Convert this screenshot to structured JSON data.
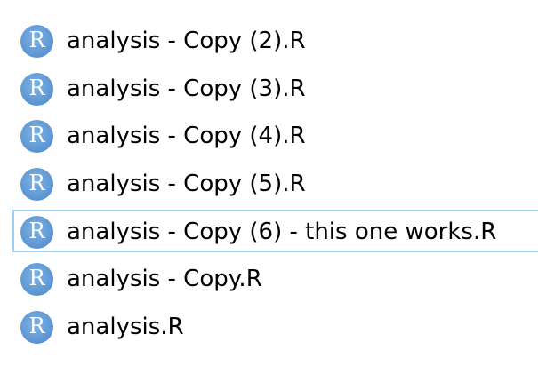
{
  "files": [
    {
      "name": "analysis - Copy (2).R",
      "icon": "r-file-icon",
      "icon_letter": "R"
    },
    {
      "name": "analysis - Copy (3).R",
      "icon": "r-file-icon",
      "icon_letter": "R"
    },
    {
      "name": "analysis - Copy (4).R",
      "icon": "r-file-icon",
      "icon_letter": "R"
    },
    {
      "name": "analysis - Copy (5).R",
      "icon": "r-file-icon",
      "icon_letter": "R"
    },
    {
      "name": "analysis - Copy (6) - this one works.R",
      "icon": "r-file-icon",
      "icon_letter": "R",
      "selected": true
    },
    {
      "name": "analysis - Copy.R",
      "icon": "r-file-icon",
      "icon_letter": "R"
    },
    {
      "name": "analysis.R",
      "icon": "r-file-icon",
      "icon_letter": "R"
    }
  ],
  "colors": {
    "icon_fill": "#5f98d4",
    "selection_border": "#9ccff5"
  }
}
